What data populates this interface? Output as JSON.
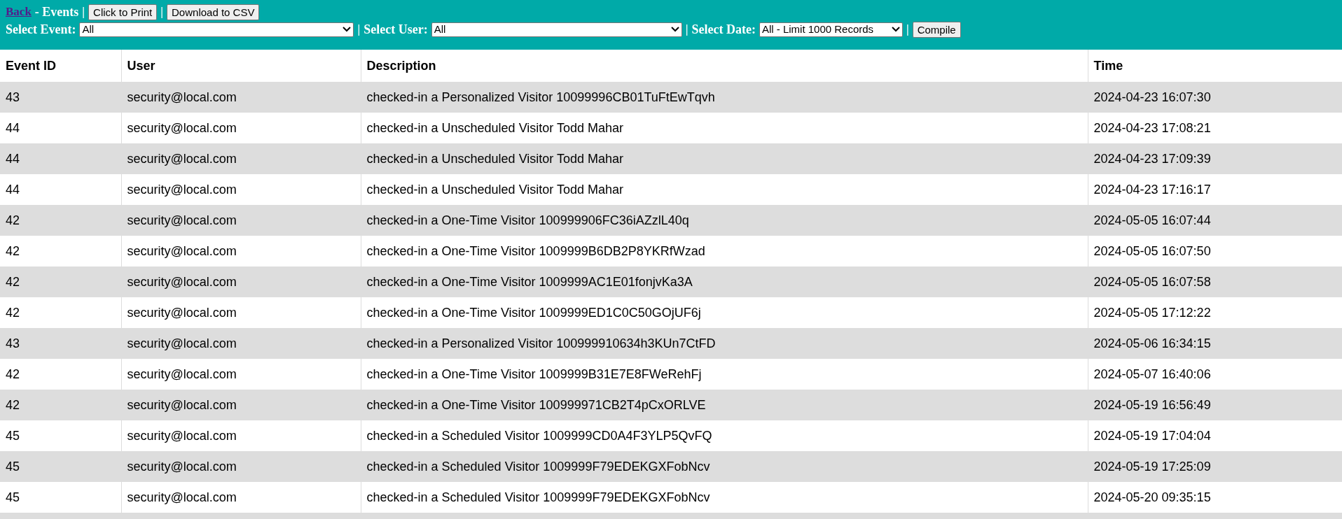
{
  "toolbar_rows": [
    [
      {
        "kind": "link",
        "text": "Back"
      },
      {
        "kind": "label",
        "text": "- Events"
      },
      {
        "kind": "separator",
        "text": "|"
      },
      {
        "kind": "button",
        "text": "Click to Print"
      },
      {
        "kind": "separator",
        "text": "|"
      },
      {
        "kind": "button",
        "text": "Download to CSV"
      }
    ],
    [
      {
        "kind": "label",
        "text": "Select Event:"
      },
      {
        "kind": "select",
        "value": "All"
      },
      {
        "kind": "separator",
        "text": "|"
      },
      {
        "kind": "label",
        "text": "Select User:"
      },
      {
        "kind": "select",
        "value": "All"
      },
      {
        "kind": "separator",
        "text": "|"
      },
      {
        "kind": "label",
        "text": "Select Date:"
      },
      {
        "kind": "select",
        "value": "All - Limit 1000 Records"
      },
      {
        "kind": "separator",
        "text": "|"
      },
      {
        "kind": "button",
        "text": "Compile"
      }
    ]
  ],
  "table": {
    "columns": [
      "Event ID",
      "User",
      "Description",
      "Time"
    ],
    "rows": [
      [
        "43",
        "security@local.com",
        "checked-in a Personalized Visitor 10099996CB01TuFtEwTqvh",
        "2024-04-23 16:07:30"
      ],
      [
        "44",
        "security@local.com",
        "checked-in a Unscheduled Visitor Todd Mahar",
        "2024-04-23 17:08:21"
      ],
      [
        "44",
        "security@local.com",
        "checked-in a Unscheduled Visitor Todd Mahar",
        "2024-04-23 17:09:39"
      ],
      [
        "44",
        "security@local.com",
        "checked-in a Unscheduled Visitor Todd Mahar",
        "2024-04-23 17:16:17"
      ],
      [
        "42",
        "security@local.com",
        "checked-in a One-Time Visitor 100999906FC36iAZzlL40q",
        "2024-05-05 16:07:44"
      ],
      [
        "42",
        "security@local.com",
        "checked-in a One-Time Visitor 1009999B6DB2P8YKRfWzad",
        "2024-05-05 16:07:50"
      ],
      [
        "42",
        "security@local.com",
        "checked-in a One-Time Visitor 1009999AC1E01fonjvKa3A",
        "2024-05-05 16:07:58"
      ],
      [
        "42",
        "security@local.com",
        "checked-in a One-Time Visitor 1009999ED1C0C50GOjUF6j",
        "2024-05-05 17:12:22"
      ],
      [
        "43",
        "security@local.com",
        "checked-in a Personalized Visitor 100999910634h3KUn7CtFD",
        "2024-05-06 16:34:15"
      ],
      [
        "42",
        "security@local.com",
        "checked-in a One-Time Visitor 1009999B31E7E8FWeRehFj",
        "2024-05-07 16:40:06"
      ],
      [
        "42",
        "security@local.com",
        "checked-in a One-Time Visitor 100999971CB2T4pCxORLVE",
        "2024-05-19 16:56:49"
      ],
      [
        "45",
        "security@local.com",
        "checked-in a Scheduled Visitor 1009999CD0A4F3YLP5QvFQ",
        "2024-05-19 17:04:04"
      ],
      [
        "45",
        "security@local.com",
        "checked-in a Scheduled Visitor 1009999F79EDEKGXFobNcv",
        "2024-05-19 17:25:09"
      ],
      [
        "45",
        "security@local.com",
        "checked-in a Scheduled Visitor 1009999F79EDEKGXFobNcv",
        "2024-05-20 09:35:15"
      ]
    ]
  }
}
